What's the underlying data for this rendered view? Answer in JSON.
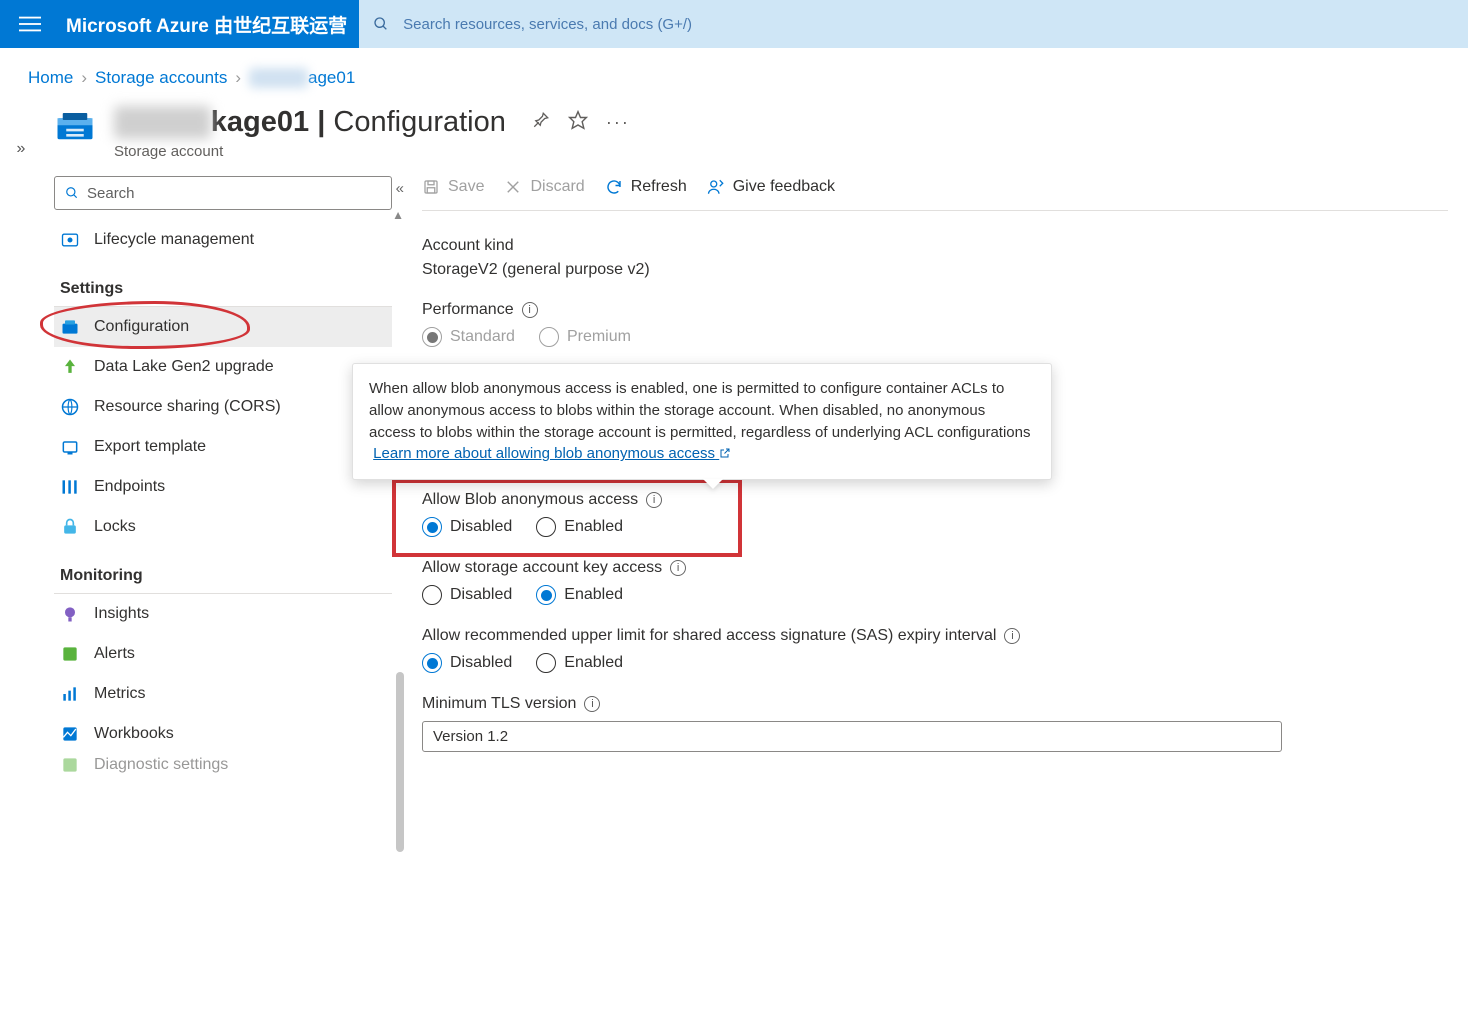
{
  "topbar": {
    "brand": "Microsoft Azure 由世纪互联运营",
    "search_placeholder": "Search resources, services, and docs (G+/)"
  },
  "breadcrumb": {
    "home": "Home",
    "storage_accounts": "Storage accounts",
    "current_masked_prefix": "xxxxxx",
    "current_suffix": "age01"
  },
  "header": {
    "name_masked": "xxxxxx",
    "name_suffix": "kage01",
    "page": "Configuration",
    "subtype": "Storage account"
  },
  "sidebar": {
    "search_placeholder": "Search",
    "top_items": [
      {
        "label": "Lifecycle management",
        "icon": "lifecycle-icon"
      }
    ],
    "sections": [
      {
        "title": "Settings",
        "items": [
          {
            "label": "Configuration",
            "icon": "configuration-icon",
            "selected": true
          },
          {
            "label": "Data Lake Gen2 upgrade",
            "icon": "upgrade-icon"
          },
          {
            "label": "Resource sharing (CORS)",
            "icon": "cors-icon"
          },
          {
            "label": "Export template",
            "icon": "export-icon"
          },
          {
            "label": "Endpoints",
            "icon": "endpoints-icon"
          },
          {
            "label": "Locks",
            "icon": "locks-icon"
          }
        ]
      },
      {
        "title": "Monitoring",
        "items": [
          {
            "label": "Insights",
            "icon": "insights-icon"
          },
          {
            "label": "Alerts",
            "icon": "alerts-icon"
          },
          {
            "label": "Metrics",
            "icon": "metrics-icon"
          },
          {
            "label": "Workbooks",
            "icon": "workbooks-icon"
          },
          {
            "label": "Diagnostic settings",
            "icon": "diagnostic-icon",
            "truncated": true
          }
        ]
      }
    ]
  },
  "commands": {
    "save": "Save",
    "discard": "Discard",
    "refresh": "Refresh",
    "feedback": "Give feedback"
  },
  "fields": {
    "account_kind": {
      "label": "Account kind",
      "value": "StorageV2 (general purpose v2)"
    },
    "performance": {
      "label": "Performance",
      "options": [
        "Standard",
        "Premium"
      ],
      "selected": "Standard",
      "readonly": true
    },
    "anon_access": {
      "label": "Allow Blob anonymous access",
      "options": [
        "Disabled",
        "Enabled"
      ],
      "selected": "Disabled"
    },
    "key_access": {
      "label": "Allow storage account key access",
      "options": [
        "Disabled",
        "Enabled"
      ],
      "selected": "Enabled"
    },
    "sas_expiry": {
      "label": "Allow recommended upper limit for shared access signature (SAS) expiry interval",
      "options": [
        "Disabled",
        "Enabled"
      ],
      "selected": "Disabled"
    },
    "tls": {
      "label": "Minimum TLS version",
      "value": "Version 1.2"
    }
  },
  "tooltip": {
    "text": "When allow blob anonymous access is enabled, one is permitted to configure container ACLs to allow anonymous access to blobs within the storage account. When disabled, no anonymous access to blobs within the storage account is permitted, regardless of underlying ACL configurations",
    "link_text": "Learn more about allowing blob anonymous access"
  }
}
